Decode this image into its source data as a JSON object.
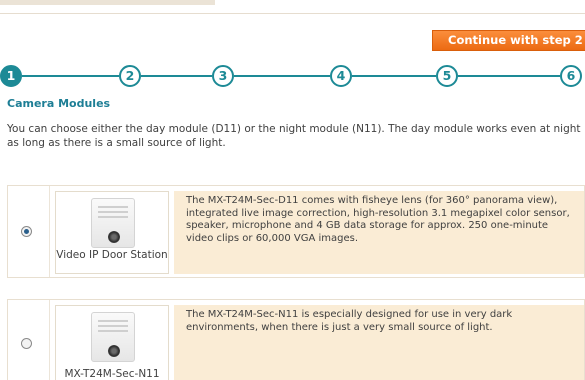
{
  "continue_button": {
    "label": "Continue with step 2"
  },
  "stepper": {
    "steps": [
      "1",
      "2",
      "3",
      "4",
      "5",
      "6"
    ],
    "active_step": "1"
  },
  "section": {
    "title": "Camera Modules",
    "intro": "You can choose either the day module (D11) or the night module (N11). The day module works even at night as long as there is a small source of light."
  },
  "modules": [
    {
      "selected": true,
      "caption": "Video IP Door Station",
      "description": "The MX-T24M-Sec-D11 comes with fisheye lens (for 360° panorama view), integrated live image correction, high-resolution 3.1 megapixel color sensor, speaker, microphone and 4 GB data storage for approx. 250 one-minute video clips or 60,000 VGA images."
    },
    {
      "selected": false,
      "caption": "MX-T24M-Sec-N11",
      "description": "The MX-T24M-Sec-N11 is especially designed for use in very dark environments, when there is just a very small source of light."
    }
  ],
  "colors": {
    "accent": "#1d8a96",
    "button": "#f07a23",
    "description_bg": "#faecd5"
  }
}
